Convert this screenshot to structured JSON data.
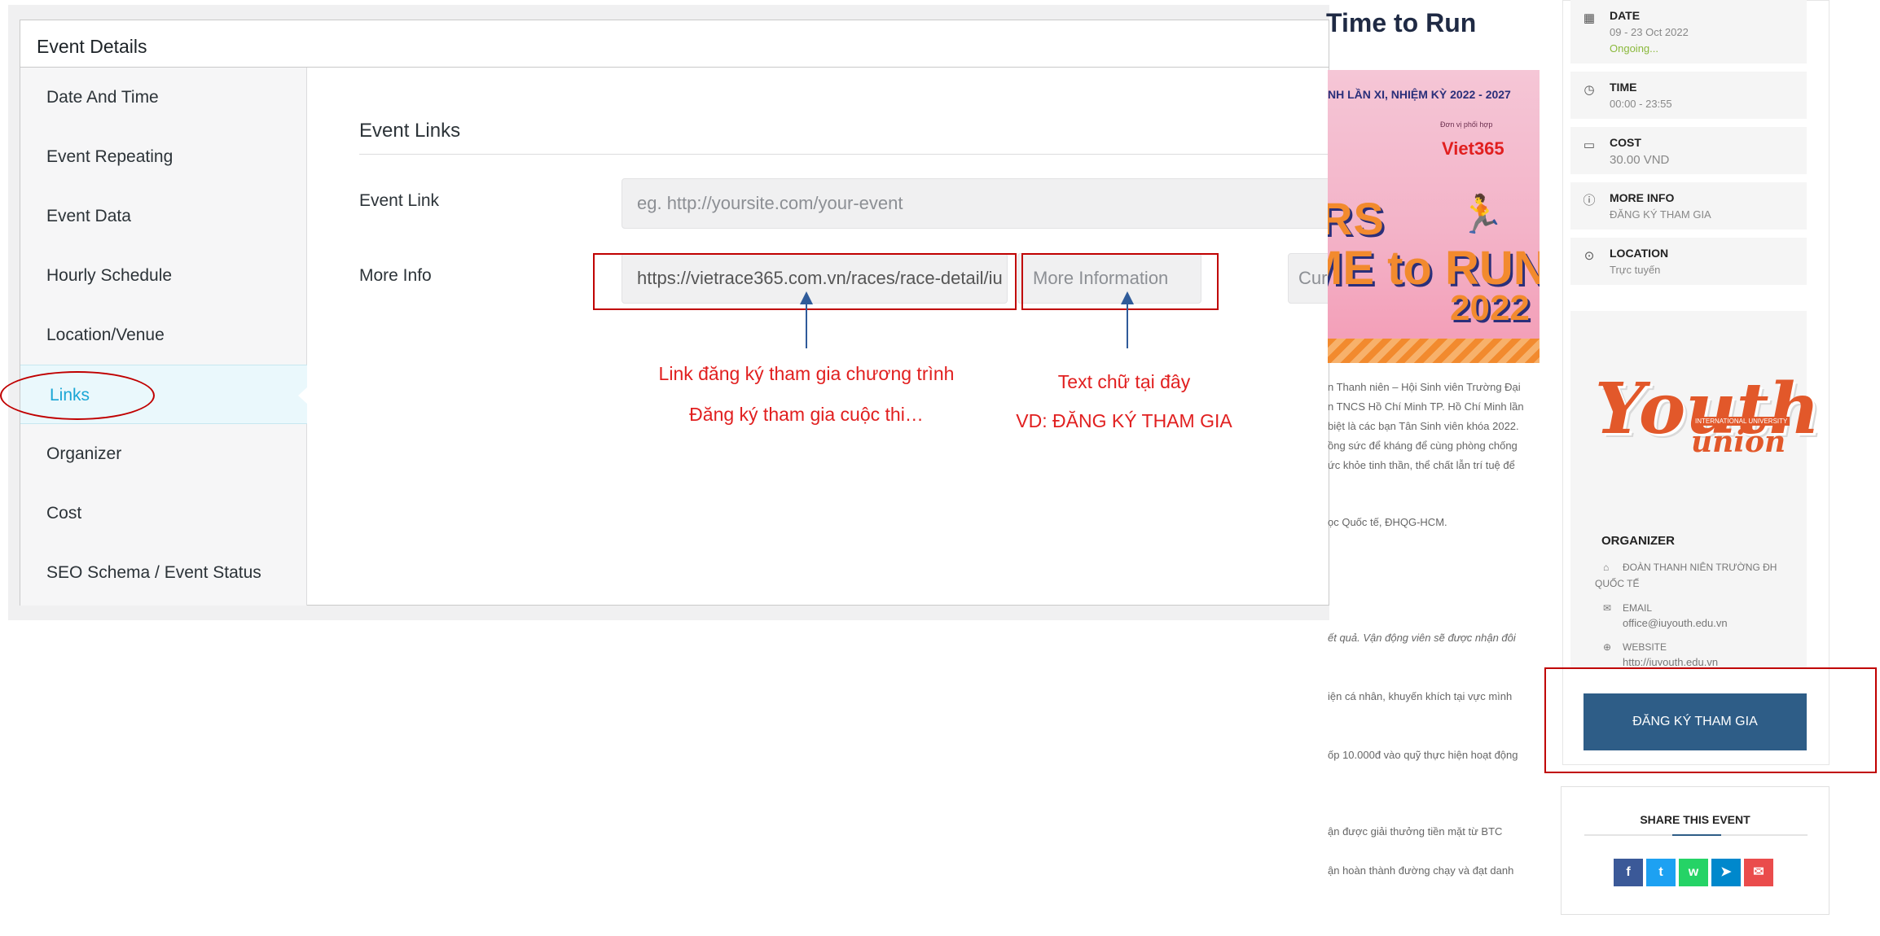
{
  "admin": {
    "title": "Event Details",
    "nav": [
      {
        "label": "Date And Time"
      },
      {
        "label": "Event Repeating"
      },
      {
        "label": "Event Data"
      },
      {
        "label": "Hourly Schedule"
      },
      {
        "label": "Location/Venue"
      },
      {
        "label": "Links",
        "active": true
      },
      {
        "label": "Organizer"
      },
      {
        "label": "Cost"
      },
      {
        "label": "SEO Schema / Event Status"
      }
    ],
    "section_title": "Event Links",
    "event_link": {
      "label": "Event Link",
      "placeholder": "eg. http://yoursite.com/your-event"
    },
    "more_info": {
      "label": "More Info",
      "url_value": "https://vietrace365.com.vn/races/race-detail/iu",
      "text_placeholder": "More Information",
      "extra_field": "Cur"
    }
  },
  "annotations": {
    "note_left_1": "Link đăng ký tham gia chương trình",
    "note_left_2": "Đăng ký tham gia cuộc thi…",
    "note_right_1": "Text chữ tại đây",
    "note_right_2": "VD: ĐĂNG KÝ THAM GIA"
  },
  "preview": {
    "title": "Time to Run",
    "poster": {
      "line1": "NH LẦN XI, NHIỆM KỲ 2022 - 2027",
      "line2": "Đơn vị phối hợp",
      "brand": "Viet365",
      "big1": "RS",
      "big2": "ME to RUN",
      "big3": "2022"
    },
    "paragraphs": [
      "n Thanh niên – Hội Sinh viên Trường Đại",
      "n TNCS Hồ Chí Minh TP. Hồ Chí Minh lần",
      "biệt là các bạn Tân Sinh viên khóa 2022.",
      "ồng sức để kháng để cùng phòng chống",
      "ức khỏe tinh thần, thể chất lẫn trí tuệ để",
      "ọc Quốc tế, ĐHQG-HCM.",
      "ết quả. Vận động viên sẽ được nhận đôi",
      "iện cá nhân, khuyến khích tại vực mình",
      "ốp 10.000đ vào quỹ thực hiện hoạt động",
      "ận được giải thưởng tiền mặt từ BTC",
      "ận hoàn thành đường chạy và đạt danh"
    ],
    "sidebar": {
      "date": {
        "label": "DATE",
        "value": "09 - 23 Oct 2022",
        "status": "Ongoing..."
      },
      "time": {
        "label": "TIME",
        "value": "00:00 - 23:55"
      },
      "cost": {
        "label": "COST",
        "value": "30.00 VND"
      },
      "more_info": {
        "label": "MORE INFO",
        "value": "ĐĂNG KÝ THAM GIA"
      },
      "location": {
        "label": "LOCATION",
        "value": "Trực tuyến"
      },
      "logo": {
        "main": "Youth",
        "sub": "union",
        "tag": "INTERNATIONAL UNIVERSITY"
      },
      "organizer": {
        "label": "ORGANIZER",
        "name_1": "ĐOÀN THANH NIÊN TRƯỜNG ĐH",
        "name_2": "QUỐC TẾ",
        "email_label": "EMAIL",
        "email": "office@iuyouth.edu.vn",
        "website_label": "WEBSITE",
        "website": "http://iuyouth.edu.vn"
      },
      "register_button": "ĐĂNG KÝ THAM GIA",
      "share": {
        "title": "SHARE THIS EVENT",
        "buttons": [
          {
            "icon": "f",
            "color": "#3b5998"
          },
          {
            "icon": "t",
            "color": "#1da1f2"
          },
          {
            "icon": "w",
            "color": "#25d366"
          },
          {
            "icon": "➤",
            "color": "#0088cc"
          },
          {
            "icon": "✉",
            "color": "#ea4c4c"
          }
        ]
      }
    }
  }
}
